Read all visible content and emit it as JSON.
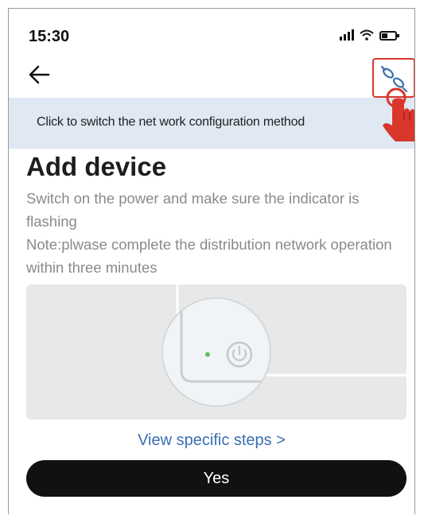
{
  "status_bar": {
    "time": "15:30"
  },
  "banner": {
    "text": "Click to switch the net work configuration method"
  },
  "main": {
    "title": "Add device",
    "instruction_line1": "Switch on the  power and make sure the indicator is flashing",
    "instruction_line2": "Note:plwase complete the distribution network operation within three minutes",
    "steps_link": "View specific steps >",
    "confirm_label": "Yes"
  },
  "icons": {
    "back": "arrow-left-icon",
    "switch_method": "link-switch-icon",
    "power": "power-icon",
    "cursor": "hand-pointer-icon"
  },
  "colors": {
    "highlight": "#d9362c",
    "banner_bg": "#dfe8f3",
    "link": "#3a6fb0",
    "indicator": "#5cc15c",
    "button_bg": "#111111"
  }
}
